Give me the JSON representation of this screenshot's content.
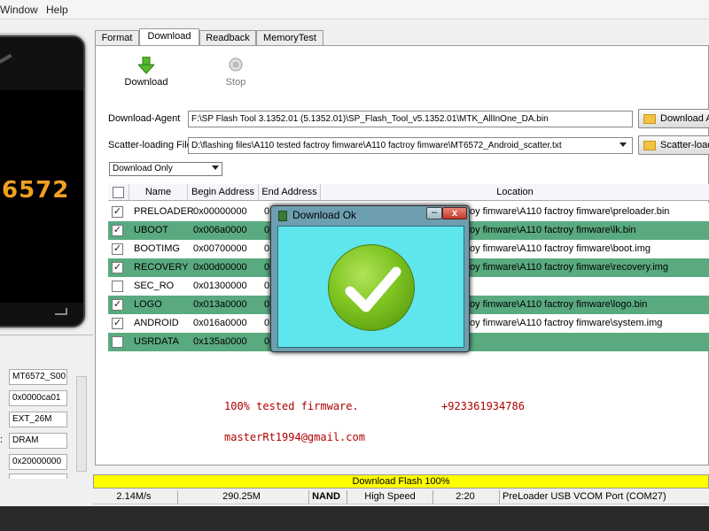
{
  "menu": [
    "Window",
    "Help"
  ],
  "phone": {
    "model_text": "6572"
  },
  "tabs": [
    {
      "label": "Format",
      "active": false
    },
    {
      "label": "Download",
      "active": true
    },
    {
      "label": "Readback",
      "active": false
    },
    {
      "label": "MemoryTest",
      "active": false
    }
  ],
  "toolbar": {
    "download_label": "Download",
    "stop_label": "Stop"
  },
  "download_agent": {
    "label": "Download-Agent",
    "value": "F:\\SP Flash Tool 3.1352.01 (5.1352.01)\\SP_Flash_Tool_v5.1352.01\\MTK_AllInOne_DA.bin",
    "button": "Download Agent"
  },
  "scatter": {
    "label": "Scatter-loading File",
    "value": "D:\\flashing files\\A110 tested factroy fimware\\A110 factroy fimware\\MT6572_Android_scatter.txt",
    "button": "Scatter-loading"
  },
  "mode_select": {
    "value": "Download Only"
  },
  "table": {
    "headers": [
      "Name",
      "Begin Address",
      "End Address",
      "Location"
    ],
    "rows": [
      {
        "checked": true,
        "name": "PRELOADER",
        "begin": "0x00000000",
        "end": "0",
        "location": "oy fimware\\A110 factroy fimware\\preloader.bin",
        "color": "white"
      },
      {
        "checked": true,
        "name": "UBOOT",
        "begin": "0x006a0000",
        "end": "0",
        "location": "oy fimware\\A110 factroy fimware\\lk.bin",
        "color": "green"
      },
      {
        "checked": true,
        "name": "BOOTIMG",
        "begin": "0x00700000",
        "end": "0",
        "location": "oy fimware\\A110 factroy fimware\\boot.img",
        "color": "white"
      },
      {
        "checked": true,
        "name": "RECOVERY",
        "begin": "0x00d00000",
        "end": "0",
        "location": "oy fimware\\A110 factroy fimware\\recovery.img",
        "color": "green"
      },
      {
        "checked": false,
        "name": "SEC_RO",
        "begin": "0x01300000",
        "end": "0",
        "location": "",
        "color": "white"
      },
      {
        "checked": true,
        "name": "LOGO",
        "begin": "0x013a0000",
        "end": "0",
        "location": "oy fimware\\A110 factroy fimware\\logo.bin",
        "color": "green"
      },
      {
        "checked": true,
        "name": "ANDROID",
        "begin": "0x016a0000",
        "end": "0",
        "location": "oy fimware\\A110 factroy fimware\\system.img",
        "color": "white"
      },
      {
        "checked": false,
        "name": "USRDATA",
        "begin": "0x135a0000",
        "end": "0",
        "location": "",
        "color": "green"
      }
    ]
  },
  "promo": {
    "tested": "100% tested firmware.",
    "phone": "+923361934786",
    "email": "masterRt1994@gmail.com"
  },
  "left_info": [
    "MT6572_S00",
    "0x0000ca01",
    "EXT_26M",
    "DRAM",
    "0x20000000"
  ],
  "left_info_prefix": ":",
  "progress": {
    "text": "Download Flash 100%"
  },
  "status": {
    "speed": "2.14M/s",
    "size": "290.25M",
    "storage": "NAND",
    "usb": "High Speed",
    "time": "2:20",
    "port": "PreLoader USB VCOM Port (COM27)"
  },
  "dialog": {
    "title": "Download Ok",
    "close": "x",
    "minimize": "–"
  },
  "colors": {
    "row_green": "#5aaa80",
    "progress": "#ffff00",
    "dialog_body": "#5ee6ec",
    "check_green": "#7dc420"
  }
}
